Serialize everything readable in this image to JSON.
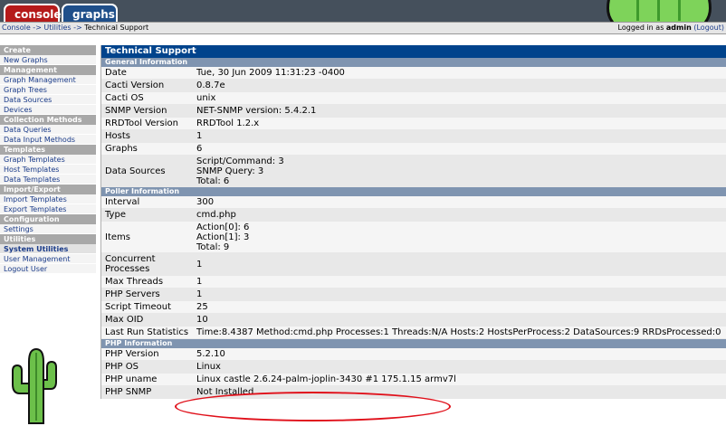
{
  "tabs": {
    "console": "console",
    "graphs": "graphs"
  },
  "breadcrumb": {
    "path": "Console -> Utilities -> ",
    "current": "Technical Support"
  },
  "login": {
    "prefix": "Logged in as ",
    "user": "admin",
    "logout": "(Logout)"
  },
  "sidebar": {
    "sections": [
      {
        "header": "Create",
        "items": [
          "New Graphs"
        ]
      },
      {
        "header": "Management",
        "items": [
          "Graph Management",
          "Graph Trees",
          "Data Sources",
          "Devices"
        ]
      },
      {
        "header": "Collection Methods",
        "items": [
          "Data Queries",
          "Data Input Methods"
        ]
      },
      {
        "header": "Templates",
        "items": [
          "Graph Templates",
          "Host Templates",
          "Data Templates"
        ]
      },
      {
        "header": "Import/Export",
        "items": [
          "Import Templates",
          "Export Templates"
        ]
      },
      {
        "header": "Configuration",
        "items": [
          "Settings"
        ]
      },
      {
        "header": "Utilities",
        "items": [
          "System Utilities",
          "User Management",
          "Logout User"
        ]
      }
    ],
    "active_item": "System Utilities"
  },
  "main": {
    "title": "Technical Support",
    "general": {
      "header": "General Information",
      "rows": [
        {
          "label": "Date",
          "value": [
            "Tue, 30 Jun 2009 11:31:23 -0400"
          ]
        },
        {
          "label": "Cacti Version",
          "value": [
            "0.8.7e"
          ]
        },
        {
          "label": "Cacti OS",
          "value": [
            "unix"
          ]
        },
        {
          "label": "SNMP Version",
          "value": [
            "NET-SNMP version: 5.4.2.1"
          ]
        },
        {
          "label": "RRDTool Version",
          "value": [
            "RRDTool 1.2.x"
          ]
        },
        {
          "label": "Hosts",
          "value": [
            "1"
          ]
        },
        {
          "label": "Graphs",
          "value": [
            "6"
          ]
        },
        {
          "label": "Data Sources",
          "value": [
            "Script/Command: 3",
            "SNMP Query: 3",
            "Total: 6"
          ]
        }
      ]
    },
    "poller": {
      "header": "Poller Information",
      "rows": [
        {
          "label": "Interval",
          "value": [
            "300"
          ]
        },
        {
          "label": "Type",
          "value": [
            "cmd.php"
          ]
        },
        {
          "label": "Items",
          "value": [
            "Action[0]: 6",
            "Action[1]: 3",
            "Total: 9"
          ]
        },
        {
          "label": "Concurrent Processes",
          "value": [
            "1"
          ]
        },
        {
          "label": "Max Threads",
          "value": [
            "1"
          ]
        },
        {
          "label": "PHP Servers",
          "value": [
            "1"
          ]
        },
        {
          "label": "Script Timeout",
          "value": [
            "25"
          ]
        },
        {
          "label": "Max OID",
          "value": [
            "10"
          ]
        },
        {
          "label": "Last Run Statistics",
          "value": [
            "Time:8.4387 Method:cmd.php Processes:1 Threads:N/A Hosts:2 HostsPerProcess:2 DataSources:9 RRDsProcessed:0"
          ]
        }
      ]
    },
    "php": {
      "header": "PHP Information",
      "rows": [
        {
          "label": "PHP Version",
          "value": [
            "5.2.10"
          ]
        },
        {
          "label": "PHP OS",
          "value": [
            "Linux"
          ]
        },
        {
          "label": "PHP uname",
          "value": [
            "Linux castle 2.6.24-palm-joplin-3430 #1 175.1.15 armv7l"
          ]
        },
        {
          "label": "PHP SNMP",
          "value": [
            "Not Installed"
          ]
        }
      ]
    }
  },
  "colors": {
    "title_bar": "#00438c",
    "section_header": "#7f94b0",
    "annotation_ellipse": "#e0101a"
  }
}
